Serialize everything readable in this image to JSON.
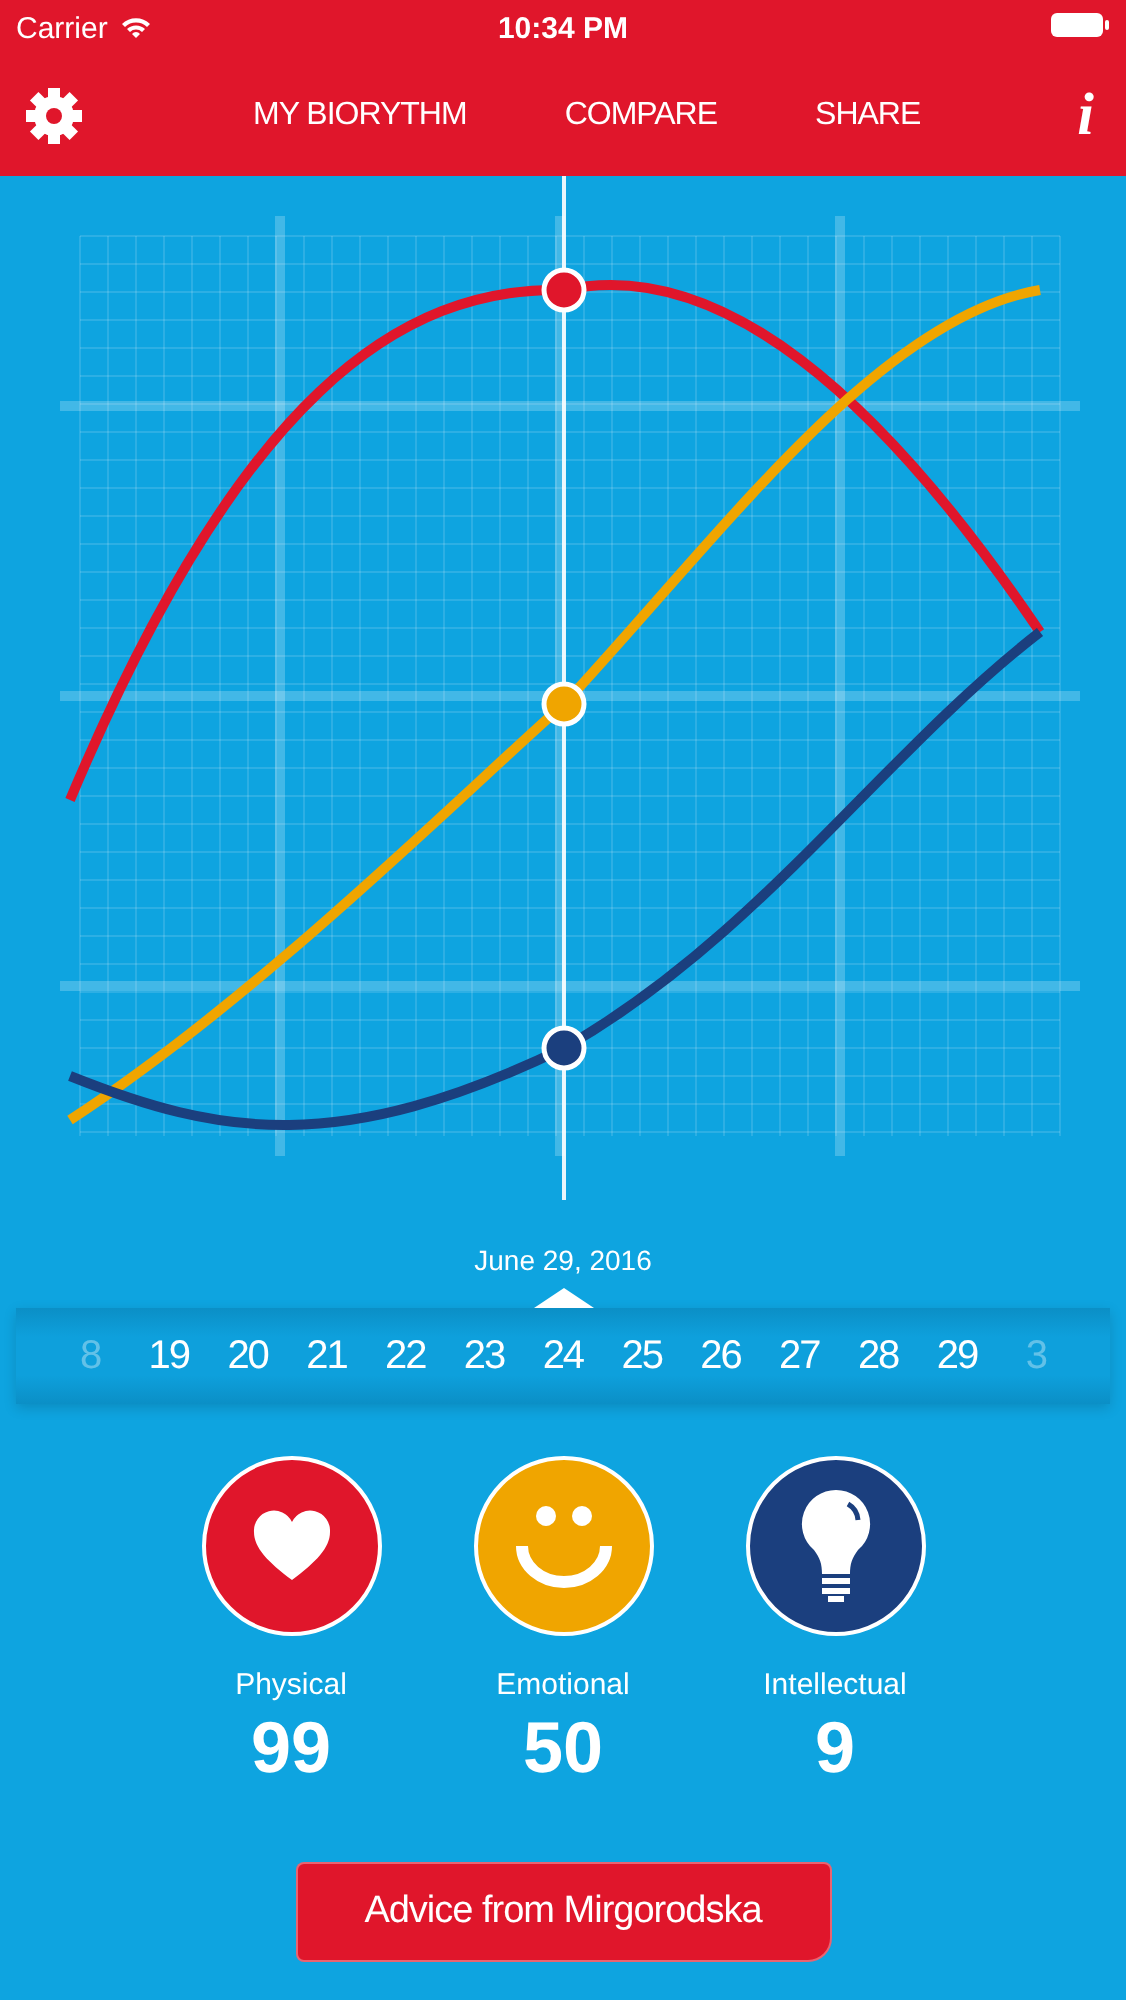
{
  "status_bar": {
    "carrier": "Carrier",
    "time": "10:34 PM"
  },
  "nav": {
    "tabs": [
      "MY BIORYTHM",
      "COMPARE",
      "SHARE"
    ],
    "info": "i"
  },
  "date_label": "June 29, 2016",
  "dates": [
    {
      "label": "8",
      "faded": true
    },
    {
      "label": "19",
      "faded": false
    },
    {
      "label": "20",
      "faded": false
    },
    {
      "label": "21",
      "faded": false
    },
    {
      "label": "22",
      "faded": false
    },
    {
      "label": "23",
      "faded": false
    },
    {
      "label": "24",
      "faded": false
    },
    {
      "label": "25",
      "faded": false
    },
    {
      "label": "26",
      "faded": false
    },
    {
      "label": "27",
      "faded": false
    },
    {
      "label": "28",
      "faded": false
    },
    {
      "label": "29",
      "faded": false
    },
    {
      "label": "3",
      "faded": true
    }
  ],
  "metrics": [
    {
      "kind": "heart",
      "name": "Physical",
      "value": "99",
      "color": "#e0162b"
    },
    {
      "kind": "smile",
      "name": "Emotional",
      "value": "50",
      "color": "#f0a500"
    },
    {
      "kind": "bulb",
      "name": "Intellectual",
      "value": "9",
      "color": "#1b3f7e"
    }
  ],
  "advice_button": "Advice from Mirgorodska"
}
